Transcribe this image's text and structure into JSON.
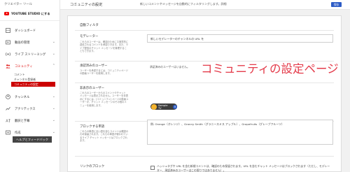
{
  "sidebar": {
    "top_label": "クリエイター ツール",
    "ytstudio_label": "YOUTUBE STUDIO にする",
    "items": [
      {
        "label": "ダッシュボード"
      },
      {
        "label": "動画の管理"
      },
      {
        "label": "ライブ ストリーミング"
      },
      {
        "label": "コミュニティ"
      },
      {
        "label": "チャンネル"
      },
      {
        "label": "アナリティクス"
      },
      {
        "label": "翻訳と字幕"
      },
      {
        "label": "作成"
      }
    ],
    "community_subitems": [
      {
        "label": "コメント"
      },
      {
        "label": "チャンネル登録者"
      },
      {
        "label": "コミュニティの設定"
      }
    ],
    "help_button": "ヘルプとフィードバック"
  },
  "header": {
    "title": "コミュニティの設定",
    "note": "新しいコメントやメッセージを自動的にフィルタリングします。詳細",
    "save": "保存"
  },
  "panel": {
    "section_title": "自動フィルタ",
    "moderators": {
      "label": "モデレーター",
      "desc": "これらのユーザーは、確認のためにネ実質的に送信されるコメントを承認できます。また、ライブ配信のチャット メッセージを管理することもできます。",
      "input": "新しいモデレーターのチャンネルの URL を"
    },
    "approved": {
      "label": "承認済みのユーザー",
      "desc": "ユーザーを承認するには、コミュニティページの動画ユーザーを使用します。",
      "value": "承認済みのユーザーはいません。"
    },
    "hidden": {
      "label": "非表示のユーザー",
      "desc": "これらのユーザーからのコメントやチャット メッセージは表示されません。ユーザーを非表示にするには、[コミュニティ] ページの動画ユーザーか、チャット メッセージのその他のメニューを使用します。",
      "chip_name": "Sample TV"
    },
    "blocked_words": {
      "label": "ブロックする単語",
      "desc": "これらの単語に近い語を含むコメントは確認のため保留されます。これらの単語が使われているライブ チャット メッセージはブロックされます。",
      "value": "例: Orange（オレンジ）、Granny Smith（グラニースミス アップル）、Grapefruits（グレープフルーツ）"
    },
    "link_block": {
      "label": "リンクのブロック",
      "text": "ハッシュタグや URL を含む新規コメントは、確認のため保留されます。URL を含むチャット メッセージはブロックされます（ただし、モデレーター、承認済みのユーザーはこの限りではありません）。"
    },
    "overlay_title": "コミュニティの設定ページ"
  },
  "colors": {
    "accent_red": "#e43c4b",
    "primary_blue": "#2d5cc6"
  }
}
